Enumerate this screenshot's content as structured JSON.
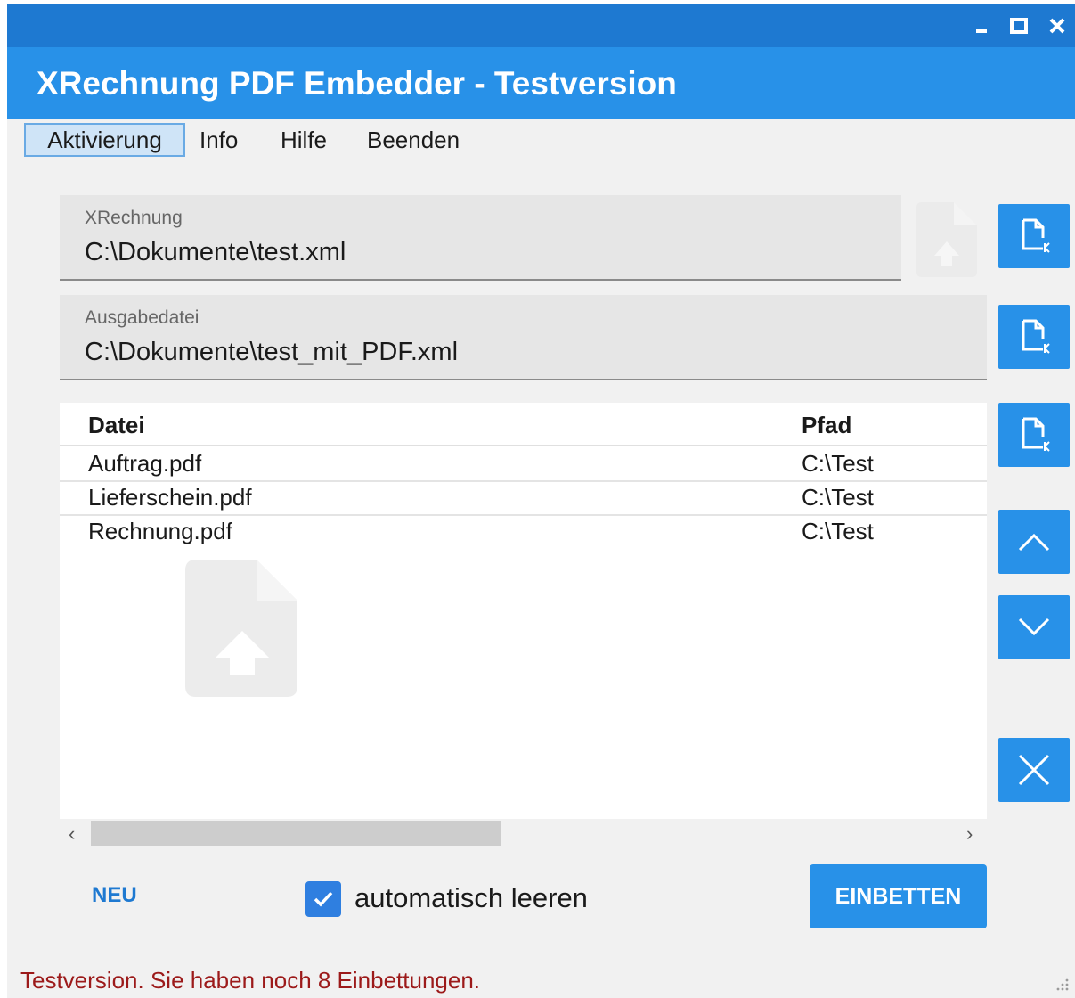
{
  "window": {
    "title": "XRechnung PDF Embedder - Testversion",
    "controls": [
      "minimize-icon",
      "maximize-icon",
      "close-icon"
    ]
  },
  "menu": {
    "items": [
      {
        "label": "Aktivierung",
        "active": true
      },
      {
        "label": "Info",
        "active": false
      },
      {
        "label": "Hilfe",
        "active": false
      },
      {
        "label": "Beenden",
        "active": false
      }
    ]
  },
  "fields": {
    "xrechnung": {
      "label": "XRechnung",
      "value": "C:\\Dokumente\\test.xml"
    },
    "output": {
      "label": "Ausgabedatei",
      "value": "C:\\Dokumente\\test_mit_PDF.xml"
    }
  },
  "table": {
    "columns": [
      "Datei",
      "Pfad"
    ],
    "rows": [
      [
        "Auftrag.pdf",
        "C:\\Test"
      ],
      [
        "Lieferschein.pdf",
        "C:\\Test"
      ],
      [
        "Rechnung.pdf",
        "C:\\Test"
      ]
    ]
  },
  "side_buttons": [
    "open-file-icon",
    "open-file-icon",
    "open-file-icon",
    "chevron-up-icon",
    "chevron-down-icon",
    "close-icon"
  ],
  "footer": {
    "new_label": "NEU",
    "auto_clear_label": "automatisch leeren",
    "auto_clear_checked": true,
    "embed_label": "EINBETTEN"
  },
  "status": {
    "text": "Testversion. Sie haben noch 8 Einbettungen."
  },
  "colors": {
    "titlebar": "#1e79d1",
    "header": "#2891e8",
    "accent": "#2891e8",
    "status_text": "#9c1a1a",
    "checkbox": "#2f7fe0"
  }
}
